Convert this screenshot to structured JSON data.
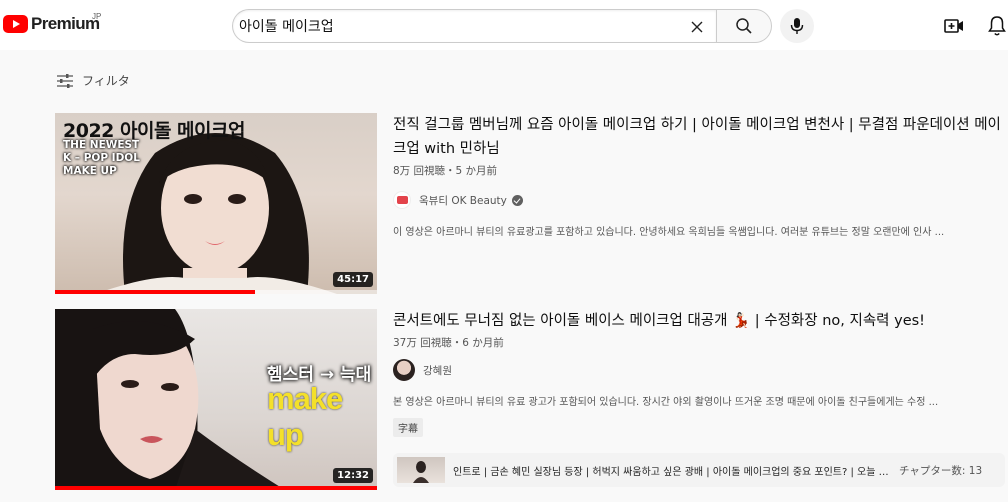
{
  "header": {
    "logo_text": "Premium",
    "region": "JP",
    "search": {
      "value": "아이돌 메이크업",
      "placeholder": ""
    }
  },
  "filter": {
    "label": "フィルタ"
  },
  "results": [
    {
      "thumbnail": {
        "headline": "2022 아이돌 메이크업",
        "subline": "THE NEWEST K – POP IDOL MAKE UP",
        "duration": "45:17",
        "watched_fraction": 0.62
      },
      "title": "전직 걸그룹 멤버님께 요즘 아이돌 메이크업 하기 | 아이돌 메이크업 변천사 | 무결점 파운데이션 메이크업 with 민하님",
      "meta": "8万 回視聴・5 か月前",
      "channel": "옥뷰티 OK Beauty",
      "verified": true,
      "description": "이 영상은 아르마니 뷰티의 유료광고를 포함하고 있습니다. 안녕하세요 옥희님들 옥쌤입니다. 여러분 유튜브는 정말 오랜만에 인사 ..."
    },
    {
      "thumbnail": {
        "headline": "헴스터 → 늑대",
        "subline": "make up",
        "duration": "12:32",
        "watched_fraction": 1.0
      },
      "title": "콘서트에도 무너짐 없는 아이돌 베이스 메이크업 대공개 💃🏻 | 수정화장 no, 지속력 yes!",
      "meta": "37万 回視聴・6 か月前",
      "channel": "강혜원",
      "verified": false,
      "description": "본 영상은 아르마니 뷰티의 유료 광고가 포함되어 있습니다. 장시간 야외 촬영이나 뜨거운 조명 때문에 아이돌 친구들에게는 수정 ...",
      "badge": "字幕",
      "chapters": {
        "text": "인트로 | 금손 혜민 실장님 등장 | 허벅지 싸움하고 싶은 광배 | 아이돌 메이크업의 중요 포인트? | 오늘 혜원이...",
        "count": "チャプター数: 13"
      }
    }
  ],
  "colors": {
    "accent": "#ff0000",
    "background": "#f9f9f9"
  },
  "icons": [
    "youtube-logo-icon",
    "clear-icon",
    "search-icon",
    "mic-icon",
    "create-video-icon",
    "bell-icon",
    "filter-icon",
    "verified-icon"
  ]
}
